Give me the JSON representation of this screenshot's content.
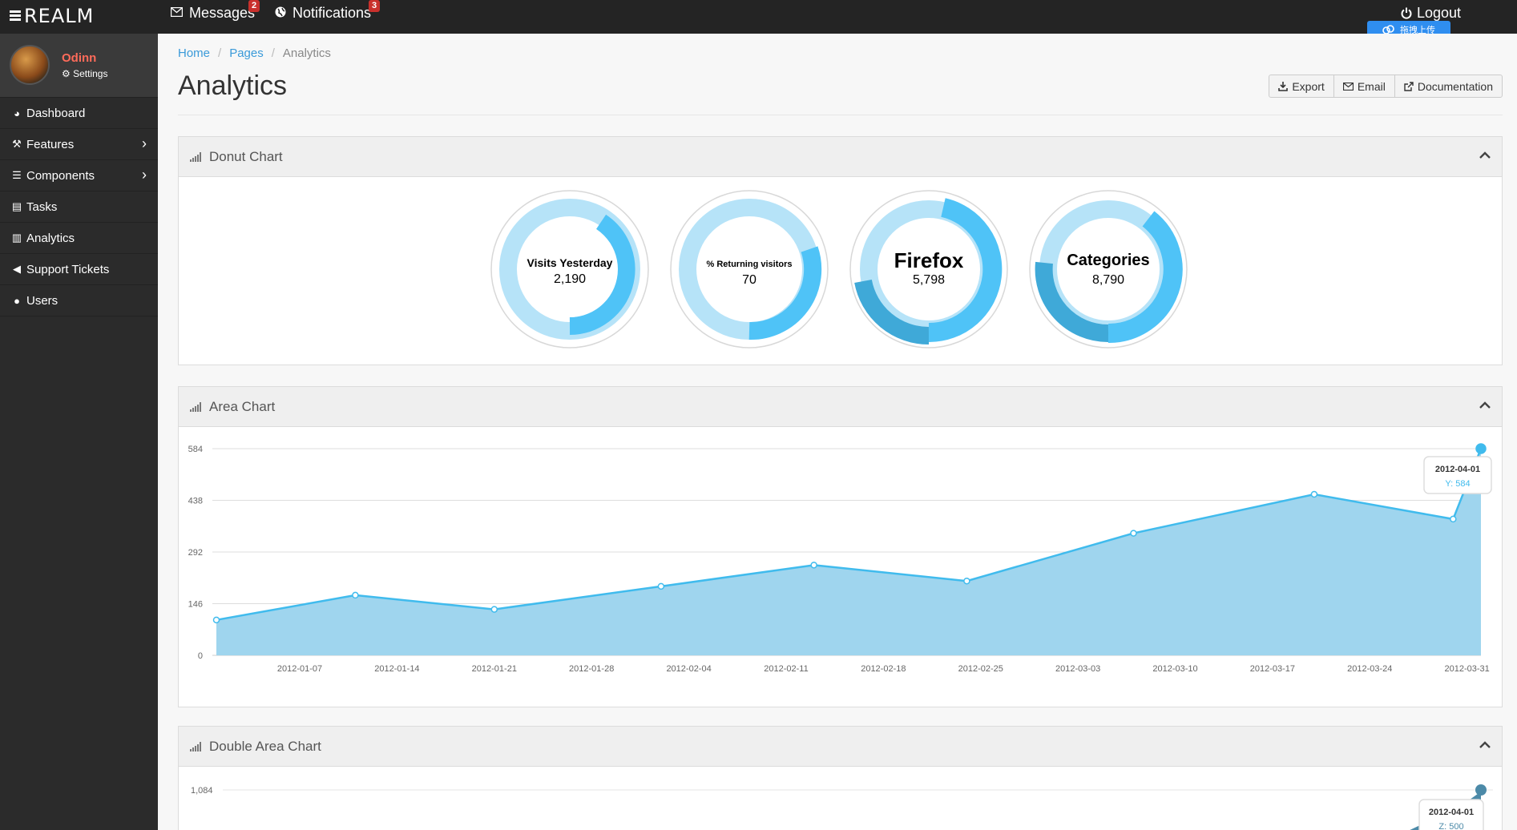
{
  "topbar": {
    "brand": "REALM",
    "messages": {
      "label": "Messages",
      "badge": "2"
    },
    "notifications": {
      "label": "Notifications",
      "badge": "3"
    },
    "logout": "Logout",
    "upload_chip": "拖拽上传"
  },
  "sidebar": {
    "user": {
      "name": "Odinn",
      "settings": "Settings"
    },
    "items": [
      {
        "label": "Dashboard",
        "icon": "dashboard-icon"
      },
      {
        "label": "Features",
        "icon": "wand-icon",
        "has_children": true
      },
      {
        "label": "Components",
        "icon": "list-icon",
        "has_children": true
      },
      {
        "label": "Tasks",
        "icon": "tasks-icon"
      },
      {
        "label": "Analytics",
        "icon": "bar-chart-icon"
      },
      {
        "label": "Support Tickets",
        "icon": "bullhorn-icon"
      },
      {
        "label": "Users",
        "icon": "user-icon"
      }
    ]
  },
  "breadcrumb": {
    "home": "Home",
    "pages": "Pages",
    "current": "Analytics"
  },
  "page": {
    "title": "Analytics",
    "buttons": {
      "export": "Export",
      "email": "Email",
      "documentation": "Documentation"
    }
  },
  "panels": {
    "donut": {
      "title": "Donut Chart"
    },
    "area": {
      "title": "Area Chart"
    },
    "double_area": {
      "title": "Double Area Chart"
    }
  },
  "colors": {
    "accent": "#3a9ad9",
    "area_fill": "#9fd5ee",
    "line": "#40bbed",
    "donut_dark": "#4fc3f7",
    "donut_light": "#b6e3f8"
  },
  "donuts": [
    {
      "label": "Visits Yesterday",
      "value": "2,190",
      "fraction": 0.4
    },
    {
      "label": "% Returning visitors",
      "value": "70",
      "fraction": 0.3
    },
    {
      "label": "Firefox",
      "value": "5,798",
      "fraction": 0.55
    },
    {
      "label": "Categories",
      "value": "8,790",
      "fraction": 0.62
    }
  ],
  "chart_data": [
    {
      "type": "area",
      "title": "Area Chart",
      "x": [
        "2012-01-01",
        "2012-01-11",
        "2012-01-21",
        "2012-02-02",
        "2012-02-13",
        "2012-02-24",
        "2012-03-07",
        "2012-03-20",
        "2012-03-30",
        "2012-04-01"
      ],
      "series": [
        {
          "values": [
            100,
            170,
            130,
            195,
            255,
            210,
            345,
            455,
            385,
            584
          ]
        }
      ],
      "yticks": [
        0,
        146,
        292,
        438,
        584
      ],
      "ytick_labels": [
        "0",
        "146",
        "292",
        "438",
        "584"
      ],
      "xtick_labels": [
        "2012-01-07",
        "2012-01-14",
        "2012-01-21",
        "2012-01-28",
        "2012-02-04",
        "2012-02-11",
        "2012-02-18",
        "2012-02-25",
        "2012-03-03",
        "2012-03-10",
        "2012-03-17",
        "2012-03-24",
        "2012-03-31"
      ],
      "ylim": [
        0,
        584
      ],
      "tooltip": {
        "date": "2012-04-01",
        "text": "Y: 584"
      },
      "grid": true
    },
    {
      "type": "area",
      "title": "Double Area Chart",
      "ytick_labels": [
        "1,084"
      ],
      "tooltip": {
        "date": "2012-04-01",
        "text": "Z: 500"
      }
    }
  ]
}
